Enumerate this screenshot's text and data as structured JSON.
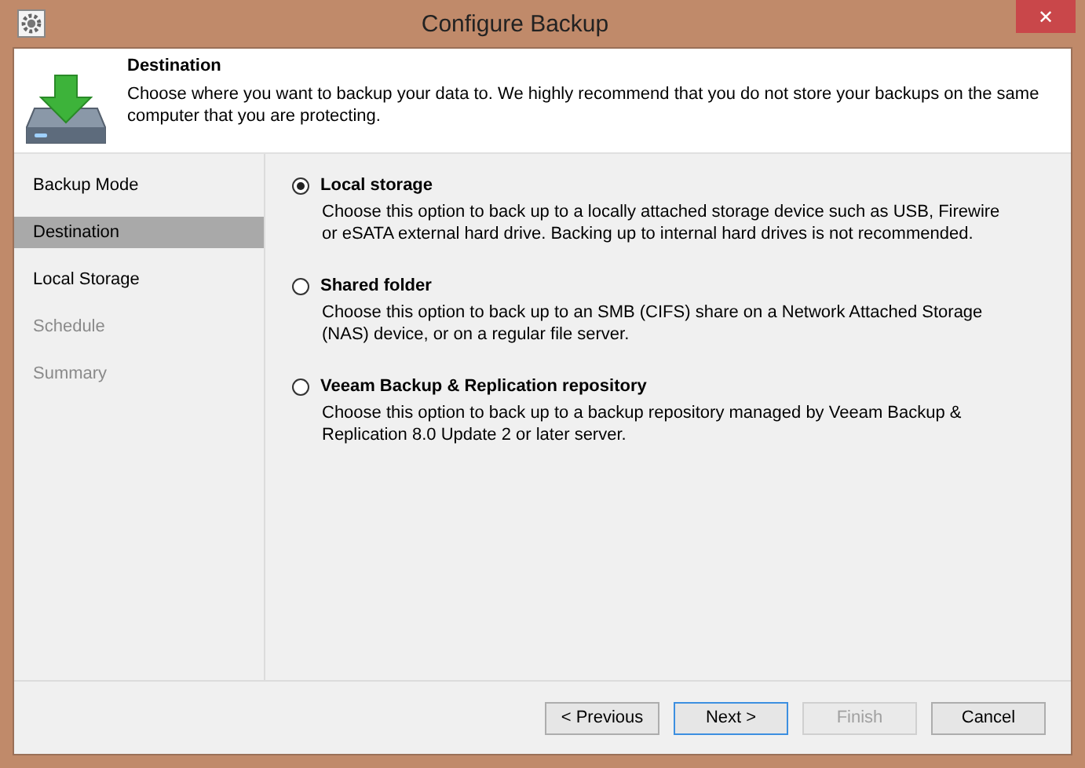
{
  "window": {
    "title": "Configure Backup",
    "close": "✕"
  },
  "header": {
    "title": "Destination",
    "description": "Choose where you want to backup your data to. We highly recommend that you do not store your backups on the same computer that you are protecting."
  },
  "sidebar": {
    "items": [
      {
        "label": "Backup Mode",
        "selected": false,
        "disabled": false
      },
      {
        "label": "Destination",
        "selected": true,
        "disabled": false
      },
      {
        "label": "Local Storage",
        "selected": false,
        "disabled": false
      },
      {
        "label": "Schedule",
        "selected": false,
        "disabled": true
      },
      {
        "label": "Summary",
        "selected": false,
        "disabled": true
      }
    ]
  },
  "options": [
    {
      "label": "Local storage",
      "description": "Choose this option to back up to a locally attached storage device such as USB, Firewire or eSATA external hard drive. Backing up to internal hard drives is not recommended.",
      "selected": true
    },
    {
      "label": "Shared folder",
      "description": "Choose this option to back up to an SMB (CIFS) share on a Network Attached Storage (NAS) device, or on a regular file server.",
      "selected": false
    },
    {
      "label": "Veeam Backup & Replication repository",
      "description": "Choose this option to back up to a backup repository managed by Veeam Backup & Replication 8.0 Update 2 or later server.",
      "selected": false
    }
  ],
  "buttons": [
    {
      "label": "< Previous",
      "default": false,
      "disabled": false
    },
    {
      "label": "Next >",
      "default": true,
      "disabled": false
    },
    {
      "label": "Finish",
      "default": false,
      "disabled": true
    },
    {
      "label": "Cancel",
      "default": false,
      "disabled": false
    }
  ]
}
